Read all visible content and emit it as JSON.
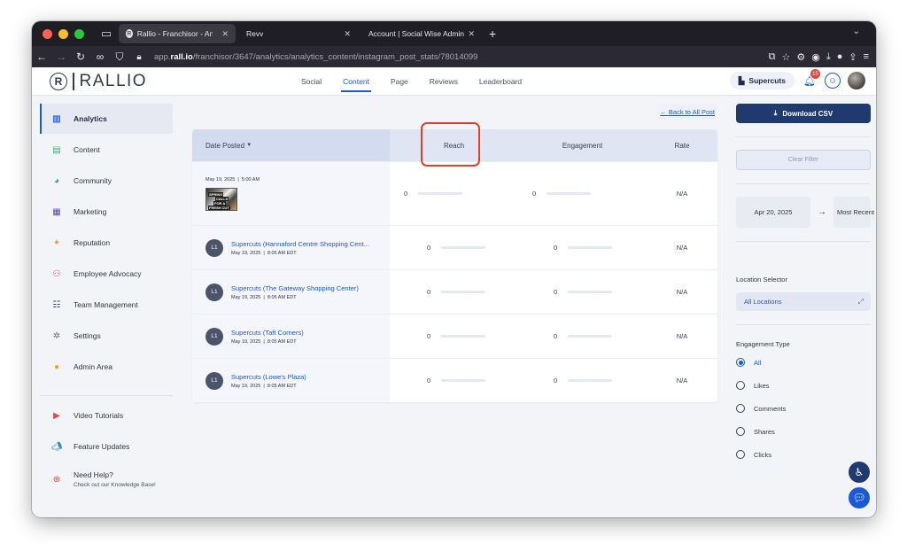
{
  "browser": {
    "tabs": [
      {
        "title": "Rallio - Franchisor - Analytics",
        "active": true
      },
      {
        "title": "Revv",
        "active": false
      },
      {
        "title": "Account | Social Wise Admin",
        "active": false
      }
    ],
    "url_prefix": "app.",
    "url_domain": "rall.io",
    "url_path": "/franchisor/3647/analytics/analytics_content/instagram_post_stats/78014099"
  },
  "header": {
    "logo_mark": "R",
    "logo_text": "RALLIO",
    "nav": [
      "Social",
      "Content",
      "Page",
      "Reviews",
      "Leaderboard"
    ],
    "active_nav": "Content",
    "brand_label": "Supercuts",
    "notification_count": "15"
  },
  "sidebar": {
    "items": [
      {
        "label": "Analytics",
        "icon": "analytics-icon"
      },
      {
        "label": "Content",
        "icon": "content-icon"
      },
      {
        "label": "Community",
        "icon": "community-icon"
      },
      {
        "label": "Marketing",
        "icon": "marketing-icon"
      },
      {
        "label": "Reputation",
        "icon": "reputation-icon"
      },
      {
        "label": "Employee Advocacy",
        "icon": "employee-advocacy-icon"
      },
      {
        "label": "Team Management",
        "icon": "team-management-icon"
      },
      {
        "label": "Settings",
        "icon": "settings-icon"
      },
      {
        "label": "Admin Area",
        "icon": "admin-area-icon"
      }
    ],
    "bottom": [
      {
        "label": "Video Tutorials",
        "icon": "video-icon"
      },
      {
        "label": "Feature Updates",
        "icon": "megaphone-icon"
      }
    ],
    "help": {
      "title": "Need Help?",
      "subtitle": "Check out our Knowledge Base!"
    }
  },
  "main": {
    "back_link": "Back to All Post",
    "columns": [
      "Date Posted",
      "Reach",
      "Engagement",
      "Rate"
    ],
    "sort_indicator": "▼",
    "first_row": {
      "date": "May 19, 2025",
      "time": "5:00 AM",
      "thumb_text": [
        "SPRING",
        "CALLS",
        "FOR A",
        "FRESH CUT"
      ],
      "reach": "0",
      "engagement": "0",
      "rate": "N/A"
    },
    "rows": [
      {
        "avatar": "L1",
        "title": "Supercuts (Hannaford Centre Shopping Cent...",
        "date": "May 19, 2025",
        "time": "8:05 AM EDT",
        "reach": "0",
        "engagement": "0",
        "rate": "N/A"
      },
      {
        "avatar": "L1",
        "title": "Supercuts (The Gateway Shopping Center)",
        "date": "May 19, 2025",
        "time": "8:05 AM EDT",
        "reach": "0",
        "engagement": "0",
        "rate": "N/A"
      },
      {
        "avatar": "L1",
        "title": "Supercuts (Taft Corners)",
        "date": "May 19, 2025",
        "time": "8:05 AM EDT",
        "reach": "0",
        "engagement": "0",
        "rate": "N/A"
      },
      {
        "avatar": "L1",
        "title": "Supercuts (Lowe's Plaza)",
        "date": "May 19, 2025",
        "time": "8:05 AM EDT",
        "reach": "0",
        "engagement": "0",
        "rate": "N/A"
      }
    ]
  },
  "right_panel": {
    "download_label": "Download CSV",
    "clear_filter_label": "Clear Filter",
    "date_from": "Apr 20, 2025",
    "date_to": "Most Recent",
    "location_selector_label": "Location Selector",
    "location_value": "All Locations",
    "engagement_type_label": "Engagement Type",
    "engagement_options": [
      "All",
      "Likes",
      "Comments",
      "Shares",
      "Clicks"
    ],
    "engagement_selected": "All"
  },
  "colors": {
    "accent": "#1a5ad7",
    "primary_button": "#1e3a6e",
    "highlight_box": "#e43d2b"
  }
}
